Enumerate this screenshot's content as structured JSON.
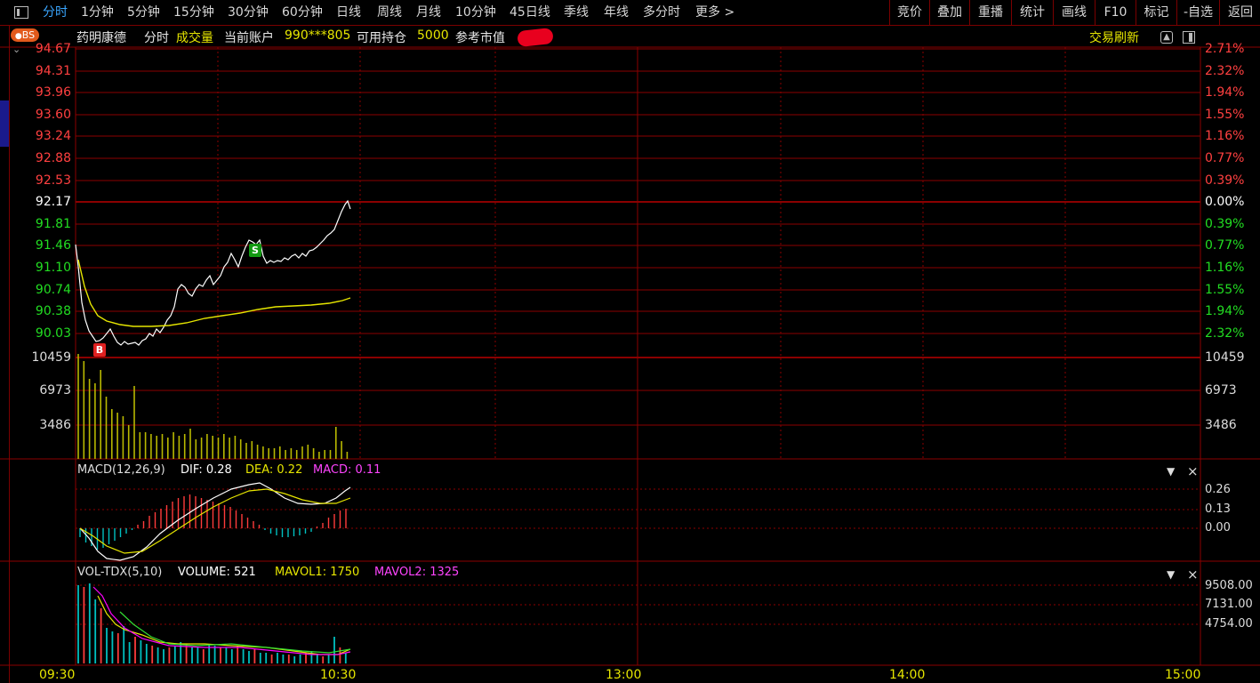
{
  "toolbar": {
    "tabs": [
      "分时",
      "1分钟",
      "5分钟",
      "15分钟",
      "30分钟",
      "60分钟",
      "日线",
      "周线",
      "月线",
      "10分钟",
      "45日线",
      "季线",
      "年线",
      "多分时",
      "更多 >"
    ],
    "right_buttons": [
      "竞价",
      "叠加",
      "重播",
      "统计",
      "画线",
      "F10",
      "标记",
      "-自选",
      "返回"
    ]
  },
  "info": {
    "bs_badge": "BS",
    "stock_name": "药明康德",
    "mode": "分时",
    "volume_label": "成交量",
    "account_label": "当前账户",
    "account_value": "990***805",
    "position_label": "可用持仓",
    "position_value": "5000",
    "market_value_label": "参考市值",
    "trade_refresh": "交易刷新"
  },
  "price_axis": {
    "left": [
      "94.67",
      "94.31",
      "93.96",
      "93.60",
      "93.24",
      "92.88",
      "92.53",
      "92.17",
      "91.81",
      "91.46",
      "91.10",
      "90.74",
      "90.38",
      "90.03"
    ],
    "right": [
      "2.71%",
      "2.32%",
      "1.94%",
      "1.55%",
      "1.16%",
      "0.77%",
      "0.39%",
      "0.00%",
      "0.39%",
      "0.77%",
      "1.16%",
      "1.55%",
      "1.94%",
      "2.32%"
    ]
  },
  "volume_axis": {
    "labels": [
      "10459",
      "6973",
      "3486"
    ]
  },
  "macd_panel": {
    "title": "MACD(12,26,9)",
    "dif": "DIF: 0.28",
    "dea": "DEA: 0.22",
    "macd": "MACD: 0.11",
    "axis": [
      "0.26",
      "0.13",
      "0.00"
    ]
  },
  "vol_panel": {
    "title": "VOL-TDX(5,10)",
    "volume": "VOLUME: 521",
    "mavol1": "MAVOL1: 1750",
    "mavol2": "MAVOL2: 1325",
    "axis": [
      "9508.00",
      "7131.00",
      "4754.00"
    ]
  },
  "time_axis": [
    "09:30",
    "10:30",
    "13:00",
    "14:00",
    "15:00"
  ],
  "markers": {
    "buy": "B",
    "sell": "S"
  },
  "panel_controls": {
    "dropdown": "▼",
    "close": "×"
  },
  "colors": {
    "up": "#ff3b3b",
    "down": "#22cc22",
    "price_line": "#ffffff",
    "avg_line": "#e6e600",
    "grid": "#8b0000",
    "macd_pos": "#ff3b3b",
    "macd_neg": "#00c0c0",
    "mavol2": "#ff00ff",
    "mavol1": "#e6e600"
  }
}
